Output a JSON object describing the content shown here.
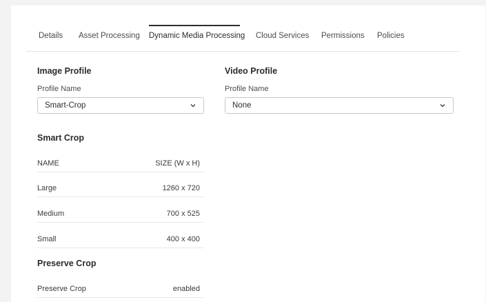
{
  "tabs": [
    {
      "label": "Details"
    },
    {
      "label": "Asset Processing"
    },
    {
      "label": "Dynamic Media Processing"
    },
    {
      "label": "Cloud Services"
    },
    {
      "label": "Permissions"
    },
    {
      "label": "Policies"
    }
  ],
  "active_tab": "Dynamic Media Processing",
  "image_profile": {
    "title": "Image Profile",
    "field_label": "Profile Name",
    "value": "Smart-Crop"
  },
  "video_profile": {
    "title": "Video Profile",
    "field_label": "Profile Name",
    "value": "None"
  },
  "smart_crop": {
    "title": "Smart Crop",
    "headers": {
      "name": "NAME",
      "size": "SIZE (W x H)"
    },
    "rows": [
      {
        "name": "Large",
        "size": "1260 x 720"
      },
      {
        "name": "Medium",
        "size": "700 x 525"
      },
      {
        "name": "Small",
        "size": "400 x 400"
      }
    ]
  },
  "preserve_crop": {
    "title": "Preserve Crop",
    "label": "Preserve Crop",
    "value": "enabled"
  },
  "icons": {
    "dropdown": "chevron-down-icon"
  },
  "colors": {
    "background": "#f3f3f3",
    "panel": "#ffffff",
    "text": "#2c2c2c",
    "border": "#c8c8c8"
  }
}
